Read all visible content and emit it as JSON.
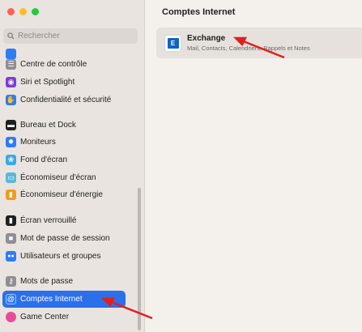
{
  "window": {
    "traffic_colors": [
      "#fe5f57",
      "#febc2e",
      "#28c840"
    ]
  },
  "search": {
    "placeholder": "Rechercher",
    "value": ""
  },
  "sidebar": {
    "items": [
      {
        "label": "Centre de contrôle",
        "icon": "control-center-icon",
        "color": "#8e8e93",
        "glyph": "☰"
      },
      {
        "label": "Siri et Spotlight",
        "icon": "siri-icon",
        "color": "#7d3bd8",
        "glyph": "◉"
      },
      {
        "label": "Confidentialité et sécurité",
        "icon": "privacy-hand-icon",
        "color": "#2c7cf6",
        "glyph": "✋"
      },
      {
        "label": "Bureau et Dock",
        "icon": "desktop-dock-icon",
        "color": "#1f1f1f",
        "glyph": "▬"
      },
      {
        "label": "Moniteurs",
        "icon": "displays-icon",
        "color": "#2c7cf6",
        "glyph": "✹"
      },
      {
        "label": "Fond d'écran",
        "icon": "wallpaper-icon",
        "color": "#39a8e8",
        "glyph": "❀"
      },
      {
        "label": "Économiseur d'écran",
        "icon": "screensaver-icon",
        "color": "#5ab8d8",
        "glyph": "▭"
      },
      {
        "label": "Économiseur d'énergie",
        "icon": "energy-saver-icon",
        "color": "#f29b1e",
        "glyph": "▮"
      },
      {
        "label": "Écran verrouillé",
        "icon": "lock-screen-icon",
        "color": "#1f1f1f",
        "glyph": "▮"
      },
      {
        "label": "Mot de passe de session",
        "icon": "login-password-icon",
        "color": "#8e8e93",
        "glyph": "■"
      },
      {
        "label": "Utilisateurs et groupes",
        "icon": "users-groups-icon",
        "color": "#2c7cf6",
        "glyph": "👥"
      },
      {
        "label": "Mots de passe",
        "icon": "passwords-key-icon",
        "color": "#8e8e93",
        "glyph": "⚷"
      },
      {
        "label": "Comptes Internet",
        "icon": "internet-accounts-icon",
        "color": "#2c7cf6",
        "glyph": "@"
      },
      {
        "label": "Game Center",
        "icon": "game-center-icon",
        "color": "#e94b9b",
        "glyph": "●"
      }
    ]
  },
  "main": {
    "title": "Comptes Internet",
    "accounts": [
      {
        "name": "Exchange",
        "services": "Mail, Contacts, Calendriers, Rappels et Notes",
        "icon_letter": "E"
      }
    ]
  },
  "annotations": {
    "arrow_color": "#e0201f"
  }
}
